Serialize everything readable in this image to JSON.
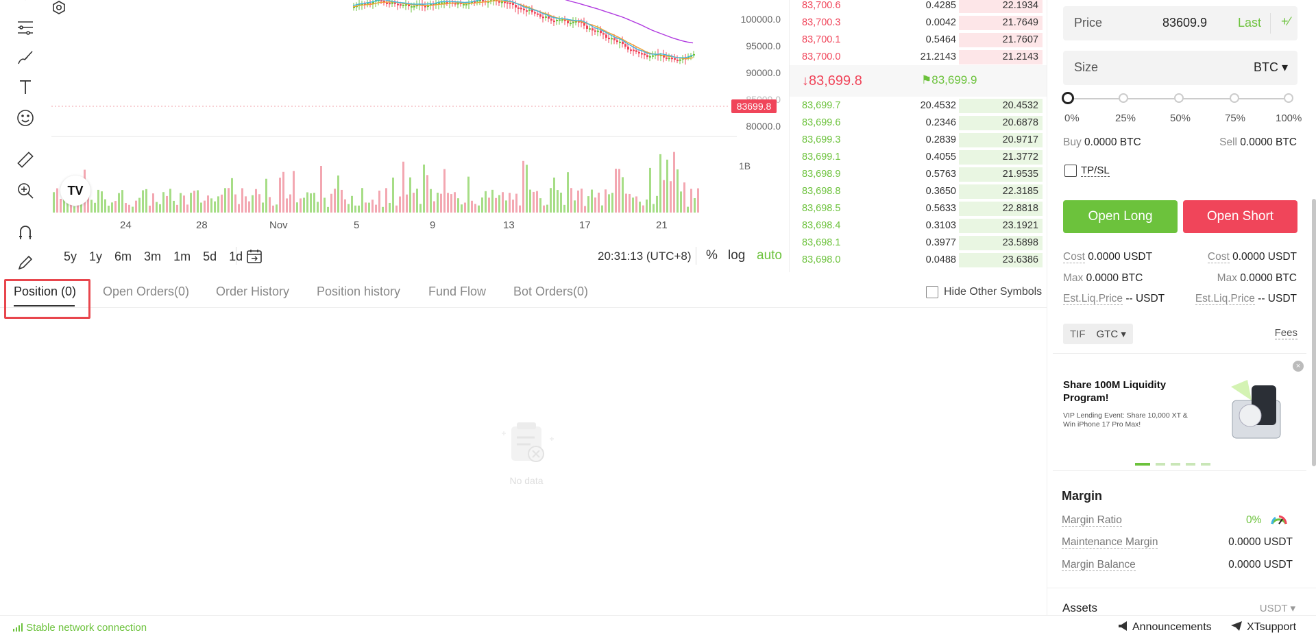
{
  "chart": {
    "price_axis": [
      "100000.0",
      "95000.0",
      "90000.0",
      "85000.0",
      "80000.0"
    ],
    "last_price_tag": "83699.8",
    "volume_axis": "1B",
    "x_labels": [
      "24",
      "28",
      "Nov",
      "5",
      "9",
      "13",
      "17",
      "21"
    ],
    "ranges": [
      "5y",
      "1y",
      "6m",
      "3m",
      "1m",
      "5d",
      "1d"
    ],
    "clock": "20:31:13 (UTC+8)",
    "pct_label": "%",
    "log_label": "log",
    "auto_label": "auto",
    "tv_logo": "TV",
    "colors": {
      "up": "#6cc23c",
      "down": "#f0455a",
      "ma_fast": "#3fb6e0",
      "ma_mid": "#f0a030",
      "ma_slow": "#b03ae0"
    }
  },
  "orderbook": {
    "asks": [
      {
        "price": "83,700.6",
        "amount": "0.4285",
        "total": "22.1934"
      },
      {
        "price": "83,700.3",
        "amount": "0.0042",
        "total": "21.7649"
      },
      {
        "price": "83,700.1",
        "amount": "0.5464",
        "total": "21.7607"
      },
      {
        "price": "83,700.0",
        "amount": "21.2143",
        "total": "21.2143"
      }
    ],
    "last_price": "83,699.8",
    "mark_price": "83,699.9",
    "bids": [
      {
        "price": "83,699.7",
        "amount": "20.4532",
        "total": "20.4532"
      },
      {
        "price": "83,699.6",
        "amount": "0.2346",
        "total": "20.6878"
      },
      {
        "price": "83,699.3",
        "amount": "0.2839",
        "total": "20.9717"
      },
      {
        "price": "83,699.1",
        "amount": "0.4055",
        "total": "21.3772"
      },
      {
        "price": "83,698.9",
        "amount": "0.5763",
        "total": "21.9535"
      },
      {
        "price": "83,698.8",
        "amount": "0.3650",
        "total": "22.3185"
      },
      {
        "price": "83,698.5",
        "amount": "0.5633",
        "total": "22.8818"
      },
      {
        "price": "83,698.4",
        "amount": "0.3103",
        "total": "23.1921"
      },
      {
        "price": "83,698.1",
        "amount": "0.3977",
        "total": "23.5898"
      },
      {
        "price": "83,698.0",
        "amount": "0.0488",
        "total": "23.6386"
      }
    ]
  },
  "order_panel": {
    "price_label": "Price",
    "price_value": "83609.9",
    "last_label": "Last",
    "pm_symbol": "+∕",
    "size_label": "Size",
    "size_unit": "BTC",
    "slider_marks": [
      "0%",
      "25%",
      "50%",
      "75%",
      "100%"
    ],
    "buy_label": "Buy",
    "buy_value": "0.0000 BTC",
    "sell_label": "Sell",
    "sell_value": "0.0000 BTC",
    "tpsl_label": "TP/SL",
    "open_long": "Open Long",
    "open_short": "Open Short",
    "cost_label": "Cost",
    "cost_long": "0.0000 USDT",
    "cost_short": "0.0000 USDT",
    "max_label": "Max",
    "max_long": "0.0000 BTC",
    "max_short": "0.0000 BTC",
    "liq_label": "Est.Liq.Price",
    "liq_long": "-- USDT",
    "liq_short": "-- USDT",
    "tif_label": "TIF",
    "tif_value": "GTC",
    "fees_label": "Fees"
  },
  "banner": {
    "title": "Share 100M Liquidity Program!",
    "subtitle": "VIP Lending Event: Share 10,000 XT & Win iPhone 17 Pro Max!",
    "close": "×"
  },
  "margin": {
    "title": "Margin",
    "ratio_label": "Margin Ratio",
    "ratio_value": "0%",
    "maint_label": "Maintenance Margin",
    "maint_value": "0.0000 USDT",
    "balance_label": "Margin Balance",
    "balance_value": "0.0000 USDT",
    "assets_label": "Assets",
    "assets_unit": "USDT"
  },
  "tabs": {
    "position": "Position (0)",
    "open_orders": "Open Orders(0)",
    "order_history": "Order History",
    "position_history": "Position history",
    "fund_flow": "Fund Flow",
    "bot_orders": "Bot Orders(0)",
    "hide_other": "Hide Other Symbols",
    "empty": "No data"
  },
  "status": {
    "network": "Stable network connection",
    "announcements": "Announcements",
    "support": "XTsupport"
  }
}
